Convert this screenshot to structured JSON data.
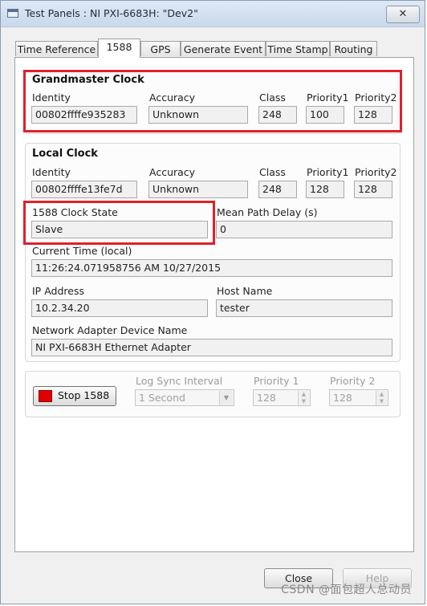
{
  "window": {
    "title": "Test Panels : NI PXI-6683H: \"Dev2\"",
    "close_glyph": "✕"
  },
  "tabs": [
    "Time Reference",
    "1588",
    "GPS",
    "Generate Event",
    "Time Stamp",
    "Routing"
  ],
  "active_tab": "1588",
  "grandmaster": {
    "title": "Grandmaster Clock",
    "identity_label": "Identity",
    "identity": "00802ffffe935283",
    "accuracy_label": "Accuracy",
    "accuracy": "Unknown",
    "class_label": "Class",
    "class": "248",
    "p1_label": "Priority1",
    "p1": "100",
    "p2_label": "Priority2",
    "p2": "128"
  },
  "local": {
    "title": "Local Clock",
    "identity_label": "Identity",
    "identity": "00802ffffe13fe7d",
    "accuracy_label": "Accuracy",
    "accuracy": "Unknown",
    "class_label": "Class",
    "class": "248",
    "p1_label": "Priority1",
    "p1": "128",
    "p2_label": "Priority2",
    "p2": "128",
    "state_label": "1588 Clock State",
    "state": "Slave",
    "delay_label": "Mean Path Delay (s)",
    "delay": "0",
    "time_label": "Current Time (local)",
    "time": "11:26:24.071958756 AM 10/27/2015",
    "ip_label": "IP Address",
    "ip": "10.2.34.20",
    "host_label": "Host Name",
    "host": "tester",
    "adapter_label": "Network Adapter Device Name",
    "adapter": "NI PXI-6683H Ethernet Adapter"
  },
  "controls": {
    "stop_label": "Stop 1588",
    "log_sync_label": "Log Sync Interval",
    "log_sync": "1 Second",
    "p1_label": "Priority 1",
    "p1": "128",
    "p2_label": "Priority 2",
    "p2": "128"
  },
  "buttons": {
    "close": "Close",
    "help": "Help"
  },
  "watermark": "CSDN @面包超人总动员",
  "colors": {
    "highlight": "#e0202a",
    "stop_indicator": "#e00000"
  }
}
